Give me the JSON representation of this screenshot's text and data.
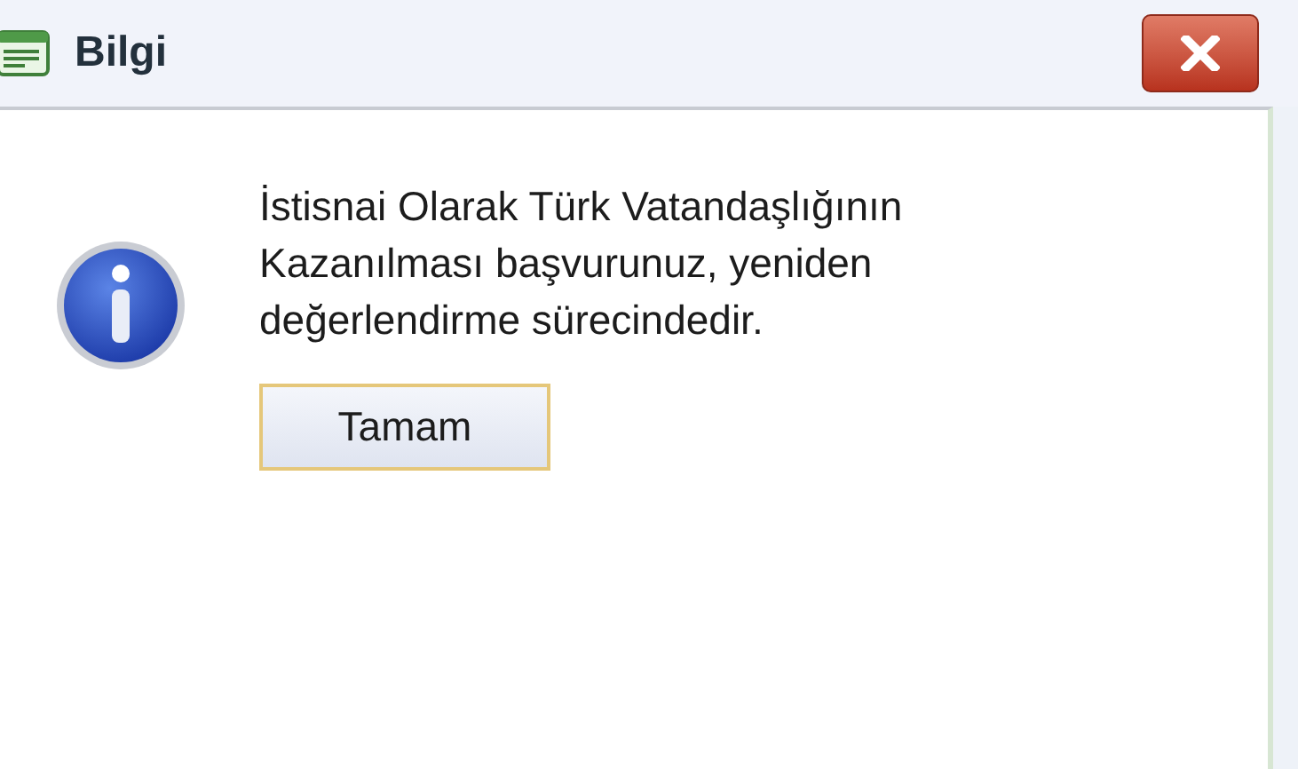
{
  "window": {
    "title": "Bilgi"
  },
  "message": {
    "lines": [
      "İstisnai Olarak Türk Vatandaşlığının",
      "Kazanılması başvurunuz, yeniden",
      "değerlendirme sürecindedir."
    ]
  },
  "buttons": [
    "Tamam"
  ]
}
